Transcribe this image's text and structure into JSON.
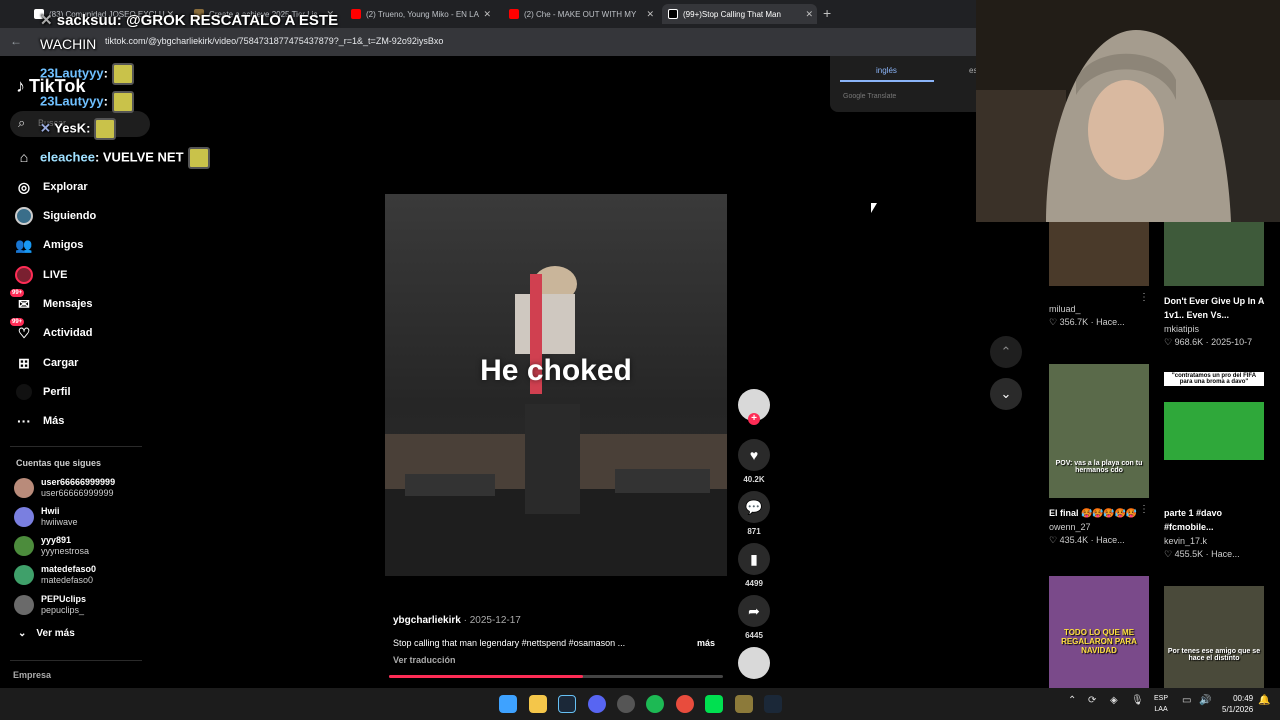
{
  "browser": {
    "tabs": [
      {
        "label": "(83) Comunidad JOSEO EXCLU",
        "color": "#ffffff",
        "active": false
      },
      {
        "label": "Create a achieve 2025 Tier Lis",
        "color": "#8a6d3b",
        "active": false
      },
      {
        "label": "(2) Trueno, Young Miko - EN LA",
        "color": "#ff0000",
        "active": false
      },
      {
        "label": "(2) Che - MAKE OUT WITH MY",
        "color": "#ff0000",
        "active": false
      },
      {
        "label": "(99+)Stop Calling That Man",
        "color": "#ffffff",
        "active": true
      }
    ],
    "url": "tiktok.com/@ybgcharliekirk/video/7584731877475437879?_r=1&_t=ZM-92o92iysBxo"
  },
  "overlay": {
    "line1_user": "sacksuu",
    "line1_text": ": @GROK RESCATALO A ESTE",
    "line2": "WACHIN",
    "chat": [
      {
        "user": "23Lautyyy",
        "text": ":"
      },
      {
        "user": "23Lautyyy",
        "text": ":"
      },
      {
        "user": "YesK",
        "text": ":"
      },
      {
        "user": "eleachee",
        "text": ": VUELVE NET"
      }
    ]
  },
  "sidebar": {
    "logo": "TikTok",
    "search_placeholder": "Buscar",
    "nav": [
      {
        "label": "Explorar",
        "icon": "compass-icon",
        "badge": ""
      },
      {
        "label": "Siguiendo",
        "icon": "following-icon",
        "badge": ""
      },
      {
        "label": "Amigos",
        "icon": "friends-icon",
        "badge": ""
      },
      {
        "label": "LIVE",
        "icon": "live-icon",
        "badge": ""
      },
      {
        "label": "Mensajes",
        "icon": "messages-icon",
        "badge": "99+"
      },
      {
        "label": "Actividad",
        "icon": "activity-icon",
        "badge": "99+"
      },
      {
        "label": "Cargar",
        "icon": "upload-icon",
        "badge": ""
      },
      {
        "label": "Perfil",
        "icon": "profile-icon",
        "badge": ""
      },
      {
        "label": "Más",
        "icon": "more-icon",
        "badge": ""
      }
    ],
    "following_title": "Cuentas que sigues",
    "following": [
      {
        "name": "user66666999999",
        "handle": "user66666999999",
        "color": "#b98b7a"
      },
      {
        "name": "Hwii",
        "handle": "hwiiwave",
        "color": "#7a7fe0"
      },
      {
        "name": "yyy891",
        "handle": "yyynestrosa",
        "color": "#4c8c3c"
      },
      {
        "name": "matedefaso0",
        "handle": "matedefaso0",
        "color": "#3fa06a"
      },
      {
        "name": "PEPUclips",
        "handle": "pepuclips_",
        "color": "#6a6a6a"
      }
    ],
    "see_more": "Ver más",
    "footer": "Empresa"
  },
  "video": {
    "overlay_text": "He choked",
    "author": "ybgcharliekirk",
    "date": "2025-12-17",
    "description": "Stop calling that man legendary #nettspend #osamason ...",
    "more": "más",
    "translate": "Ver traducción",
    "progress": 0.58
  },
  "actions": {
    "likes": "40.2K",
    "comments": "871",
    "saves": "4499",
    "shares": "6445"
  },
  "translate_popup": {
    "lang_from": "inglés",
    "lang_to": "es",
    "brand": "Google Translate"
  },
  "recommendations": [
    {
      "title": "",
      "author": "miluad_",
      "views": "356.7K",
      "age": "Hace...",
      "thumb_color": "#4a3a2a",
      "thumb_text": ""
    },
    {
      "title": "Don't Ever Give Up In A 1v1.. Even Vs...",
      "author": "mkiatipis",
      "views": "968.6K",
      "age": "2025-10-7",
      "thumb_color": "#3e5a3a",
      "thumb_text": ""
    },
    {
      "title": "El final 🥵🥵🥵🥵🥵",
      "author": "owenn_27",
      "views": "435.4K",
      "age": "Hace...",
      "thumb_color": "#5a6a4a",
      "thumb_text": "POV: vas a la playa con tu hermanos cdo"
    },
    {
      "title": "parte 1 #davo #fcmobile...",
      "author": "kevin_17.k",
      "views": "455.5K",
      "age": "Hace...",
      "thumb_color": "#2fa83a",
      "thumb_text": "\"contratamos un pro del FIFA para una broma a davo\""
    },
    {
      "title": "",
      "author": "",
      "views": "",
      "age": "",
      "thumb_color": "#7a4a8a",
      "thumb_text": "TODO LO QUE ME REGALARON PARA NAVIDAD"
    },
    {
      "title": "",
      "author": "",
      "views": "",
      "age": "",
      "thumb_color": "#4a4a3a",
      "thumb_text": "Por tenes ese amigo que se hace el distinto"
    }
  ],
  "taskbar": {
    "lang_top": "ESP",
    "lang_bottom": "LAA",
    "time": "00:49",
    "date": "5/1/2026"
  }
}
